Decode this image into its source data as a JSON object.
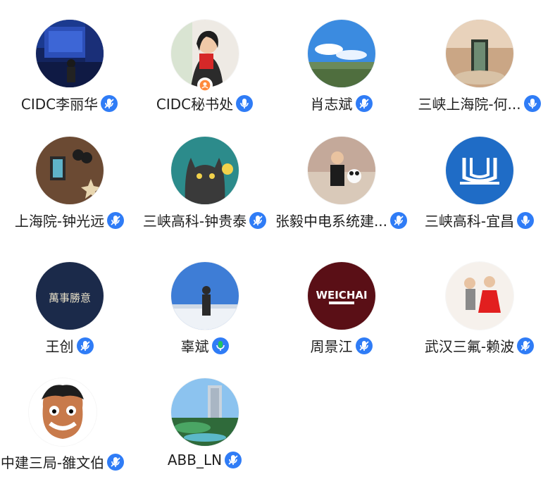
{
  "participants": [
    {
      "name": "CIDC李丽华",
      "mic": "muted",
      "avatar": "photo-stage",
      "mic_icon": "mic-muted-icon"
    },
    {
      "name": "CIDC秘书处",
      "mic": "active",
      "avatar": "photo-woman-red-book",
      "mic_icon": "mic-icon",
      "badge": "host-badge-icon"
    },
    {
      "name": "肖志斌",
      "mic": "muted",
      "avatar": "photo-sky-landscape",
      "mic_icon": "mic-muted-icon"
    },
    {
      "name": "三峡上海院-何...",
      "mic": "active",
      "avatar": "photo-glass-tower",
      "mic_icon": "mic-icon"
    },
    {
      "name": "上海院-钟光远",
      "mic": "muted",
      "avatar": "photo-wooden-desk",
      "mic_icon": "mic-muted-icon"
    },
    {
      "name": "三峡高科-钟贵泰",
      "mic": "muted",
      "avatar": "illustration-black-cat",
      "mic_icon": "mic-muted-icon"
    },
    {
      "name": "张毅中电系统建...",
      "mic": "muted",
      "avatar": "photo-child-panda",
      "mic_icon": "mic-muted-icon"
    },
    {
      "name": "三峡高科-宜昌",
      "mic": "active",
      "avatar": "logo-blue-circle",
      "mic_icon": "mic-icon"
    },
    {
      "name": "王创",
      "mic": "muted",
      "avatar": "logo-wanshi-shengyi",
      "mic_icon": "mic-muted-icon",
      "avatar_text": "萬事勝意"
    },
    {
      "name": "辜斌",
      "mic": "speaking",
      "avatar": "photo-man-clouds",
      "mic_icon": "mic-speaking-icon"
    },
    {
      "name": "周景江",
      "mic": "muted",
      "avatar": "logo-weichai",
      "mic_icon": "mic-muted-icon",
      "avatar_text": "WEICHAI"
    },
    {
      "name": "武汉三氟-赖波",
      "mic": "muted",
      "avatar": "photo-two-children",
      "mic_icon": "mic-muted-icon"
    },
    {
      "name": "中建三局-雒文伯",
      "mic": "muted",
      "avatar": "cartoon-boy",
      "mic_icon": "mic-muted-icon"
    },
    {
      "name": "ABB_LN",
      "mic": "muted",
      "avatar": "photo-hotel-garden",
      "mic_icon": "mic-muted-icon"
    }
  ],
  "colors": {
    "mic_blue": "#2f7cf6",
    "mic_green": "#22c55e",
    "name_text": "#1f1f1f",
    "host_badge": "#ff8a3d"
  }
}
